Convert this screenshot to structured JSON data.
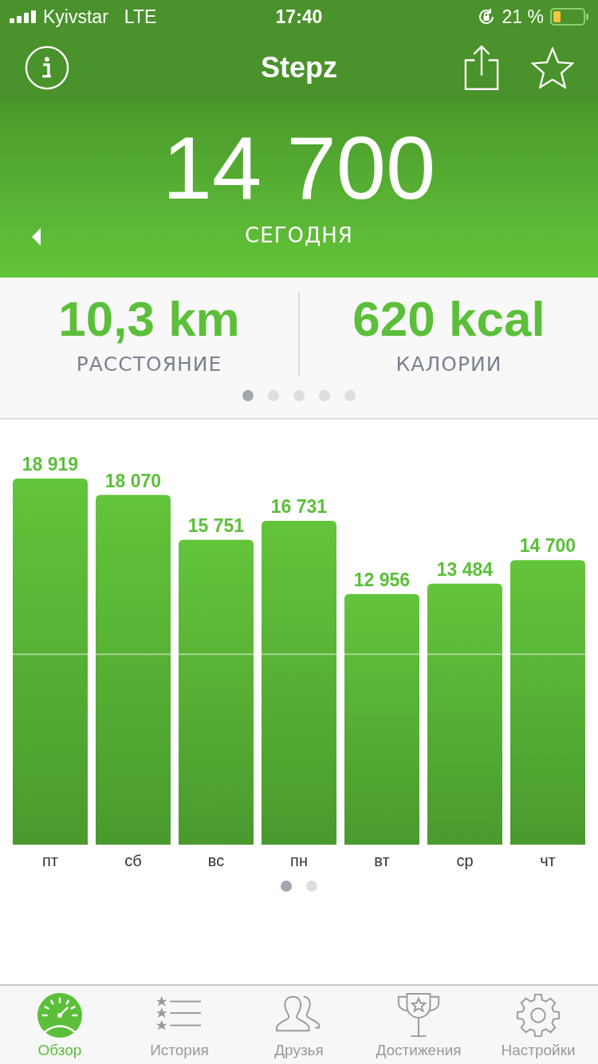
{
  "status_bar": {
    "carrier": "Kyivstar",
    "network": "LTE",
    "time": "17:40",
    "battery": "21 %"
  },
  "nav": {
    "title": "Stepz"
  },
  "today": {
    "steps": "14 700",
    "label": "СЕГОДНЯ"
  },
  "stats": [
    {
      "value": "10,3 km",
      "label": "РАССТОЯНИЕ"
    },
    {
      "value": "620 kcal",
      "label": "КАЛОРИИ"
    }
  ],
  "stats_pages": [
    {
      "selected": true
    },
    {
      "selected": false
    },
    {
      "selected": false
    },
    {
      "selected": false
    },
    {
      "selected": false
    }
  ],
  "chart": {
    "chart_data": {
      "type": "bar",
      "categories": [
        "пт",
        "сб",
        "вс",
        "пн",
        "вт",
        "ср",
        "чт"
      ],
      "series": [
        {
          "color": "#5cbf3a",
          "values": [
            18919,
            18070,
            15751,
            16731,
            12956,
            13484,
            14700
          ]
        }
      ],
      "value_labels": [
        "18 919",
        "18 070",
        "15 751",
        "16 731",
        "12 956",
        "13 484",
        "14 700"
      ],
      "ylim": [
        0,
        18919
      ],
      "data_labels": true
    }
  },
  "chart_pages": [
    {
      "selected": true
    },
    {
      "selected": false
    }
  ],
  "tab_bar": [
    {
      "label": "Обзор",
      "selected": true
    },
    {
      "label": "История",
      "selected": false
    },
    {
      "label": "Друзья",
      "selected": false
    },
    {
      "label": "Достижения",
      "selected": false
    },
    {
      "label": "Настройки",
      "selected": false
    }
  ]
}
